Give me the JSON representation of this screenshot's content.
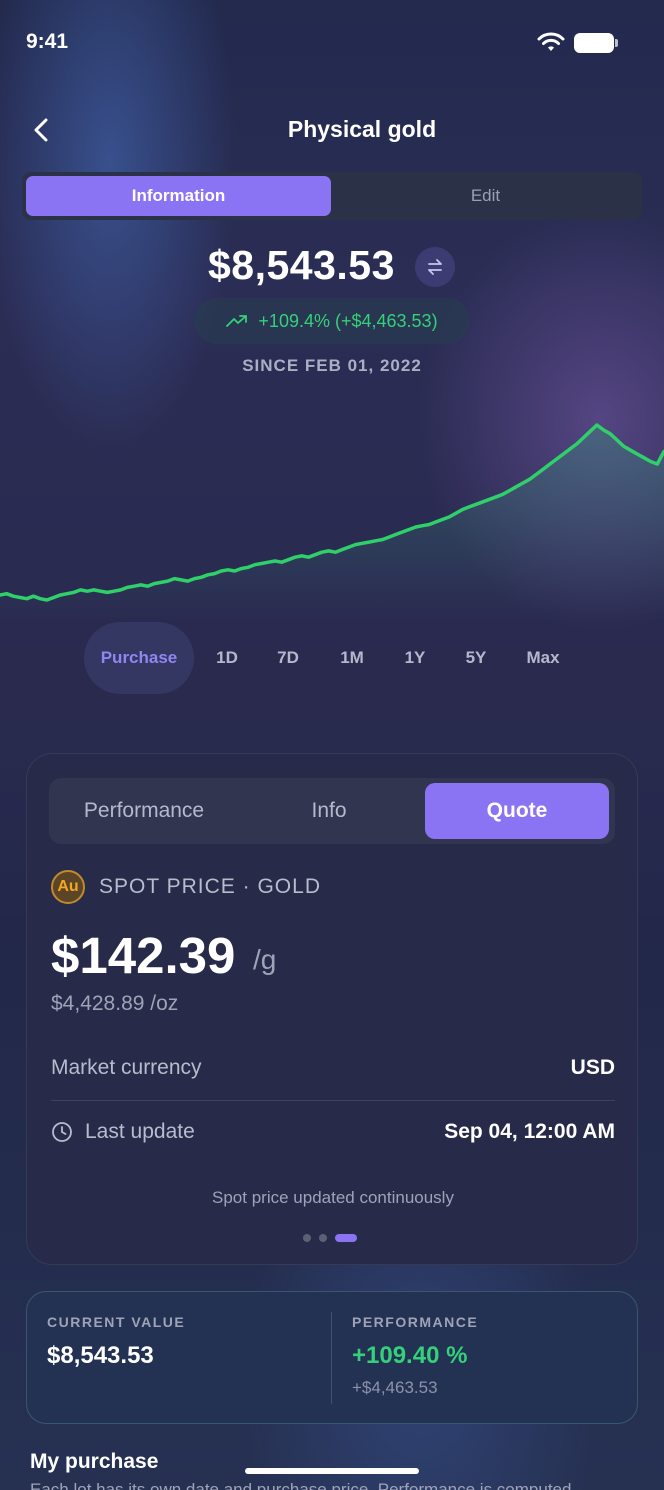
{
  "status_bar": {
    "time": "9:41"
  },
  "nav": {
    "title": "Physical gold"
  },
  "top_segment": {
    "information": "Information",
    "edit": "Edit"
  },
  "summary": {
    "price": "$8,543.53",
    "change": "+109.4% (+$4,463.53)",
    "since": "SINCE FEB 01, 2022"
  },
  "ranges": [
    "Purchase",
    "1D",
    "7D",
    "1M",
    "1Y",
    "5Y",
    "Max"
  ],
  "quote_card": {
    "tabs": [
      "Performance",
      "Info",
      "Quote"
    ],
    "au_symbol": "Au",
    "spot_label": "SPOT PRICE · GOLD",
    "price": "$142.39",
    "unit": "/g",
    "per_oz": "$4,428.89 /oz",
    "market_currency_label": "Market currency",
    "market_currency_value": "USD",
    "last_update_label": "Last update",
    "last_update_value": "Sep 04, 12:00 AM",
    "note": "Spot price updated continuously"
  },
  "value_card": {
    "current_value_label": "CURRENT VALUE",
    "current_value": "$8,543.53",
    "performance_label": "PERFORMANCE",
    "performance": "+109.40 %",
    "performance_abs": "+$4,463.53"
  },
  "my_purchase": {
    "title": "My purchase",
    "description": "Each lot has its own date and purchase price. Performance is computed"
  },
  "colors": {
    "accent": "#8a74f4",
    "positive": "#34d07a",
    "line": "#2fd06a"
  },
  "chart_data": {
    "type": "line",
    "x": [
      0,
      1,
      2,
      3,
      4,
      5,
      6,
      7,
      8,
      9,
      10,
      11,
      12,
      13,
      14,
      15,
      16,
      17,
      18,
      19,
      20,
      21,
      22,
      23,
      24,
      25,
      26,
      27,
      28,
      29,
      30,
      31,
      32,
      33,
      34,
      35,
      36,
      37,
      38,
      39,
      40,
      41,
      42,
      43,
      44,
      45,
      46,
      47,
      48,
      49,
      50,
      51,
      52,
      53,
      54,
      55,
      56,
      57,
      58,
      59,
      60,
      61,
      62,
      63,
      64,
      65,
      66,
      67,
      68,
      69,
      70,
      71,
      72,
      73,
      74,
      75,
      76,
      77,
      78,
      79,
      80,
      81,
      82,
      83,
      84,
      85,
      86,
      87,
      88,
      89,
      90,
      91,
      92,
      93,
      94,
      95,
      96,
      97,
      98,
      99
    ],
    "values": [
      100,
      101,
      99,
      98,
      97,
      99,
      97,
      96,
      98,
      100,
      101,
      102,
      104,
      103,
      104,
      103,
      102,
      103,
      104,
      106,
      107,
      108,
      107,
      109,
      110,
      111,
      113,
      112,
      111,
      113,
      114,
      116,
      117,
      119,
      120,
      119,
      121,
      122,
      124,
      125,
      126,
      127,
      126,
      128,
      130,
      131,
      130,
      132,
      134,
      135,
      134,
      136,
      138,
      140,
      141,
      142,
      143,
      144,
      146,
      148,
      150,
      152,
      154,
      155,
      156,
      158,
      160,
      162,
      165,
      168,
      170,
      172,
      174,
      176,
      178,
      180,
      183,
      186,
      189,
      192,
      196,
      200,
      204,
      208,
      212,
      216,
      220,
      225,
      230,
      235,
      231,
      228,
      223,
      218,
      215,
      212,
      209,
      206,
      204,
      214
    ],
    "xlabel": "",
    "ylabel": ""
  }
}
